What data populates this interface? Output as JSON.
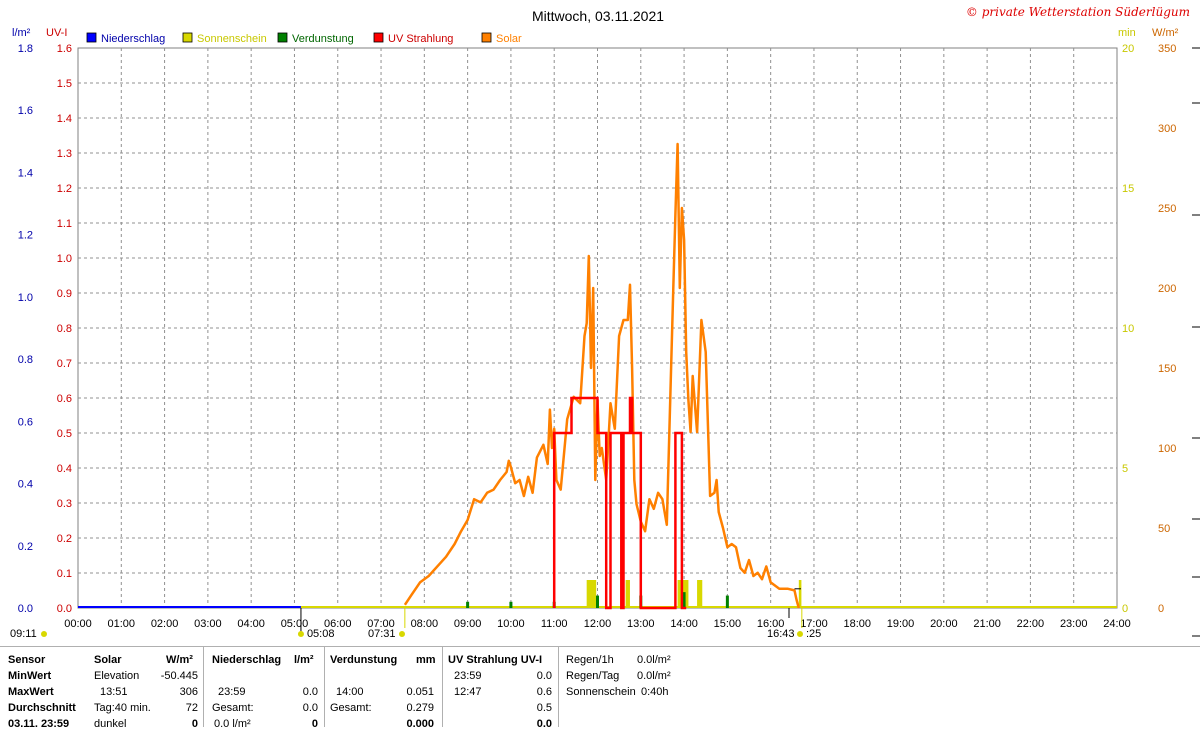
{
  "chart_data": {
    "type": "line",
    "title": "Mittwoch, 03.11.2021",
    "copyright": "© private Wetterstation Süderlügum",
    "axes": {
      "left_outer": {
        "unit": "l/m²",
        "min": 0,
        "max": 1.8,
        "ticks": [
          "0.0",
          "0.2",
          "0.4",
          "0.6",
          "0.8",
          "1.0",
          "1.2",
          "1.4",
          "1.6",
          "1.8"
        ],
        "color": "#0000aa"
      },
      "left_inner": {
        "unit": "UV-I",
        "min": 0,
        "max": 1.6,
        "ticks": [
          "0.0",
          "0.1",
          "0.2",
          "0.3",
          "0.4",
          "0.5",
          "0.6",
          "0.7",
          "0.8",
          "0.9",
          "1.0",
          "1.1",
          "1.2",
          "1.3",
          "1.4",
          "1.5",
          "1.6"
        ],
        "color": "#cc0000"
      },
      "right_inner": {
        "unit": "min",
        "min": 0,
        "max": 20,
        "ticks": [
          "0",
          "5",
          "10",
          "15",
          "20"
        ],
        "color": "#c8c800"
      },
      "right_outer": {
        "unit": "W/m²",
        "min": 0,
        "max": 350,
        "ticks": [
          "0",
          "50",
          "100",
          "150",
          "200",
          "250",
          "300",
          "350"
        ],
        "color": "#cc6600"
      },
      "x": {
        "min": 0,
        "max": 24,
        "ticks": [
          "00:00",
          "01:00",
          "02:00",
          "03:00",
          "04:00",
          "05:00",
          "06:00",
          "07:00",
          "08:00",
          "09:00",
          "10:00",
          "11:00",
          "12:00",
          "13:00",
          "14:00",
          "15:00",
          "16:00",
          "17:00",
          "18:00",
          "19:00",
          "20:00",
          "21:00",
          "22:00",
          "23:00",
          "24:00"
        ]
      }
    },
    "grid": true,
    "legend_position": "top-left",
    "legend": [
      {
        "name": "Niederschlag",
        "color": "#0000ff",
        "text_color": "#0000aa"
      },
      {
        "name": "Sonnenschein",
        "color": "#d8d800",
        "text_color": "#c8c800"
      },
      {
        "name": "Verdunstung",
        "color": "#008000",
        "text_color": "#006600"
      },
      {
        "name": "UV Strahlung",
        "color": "#ff0000",
        "text_color": "#cc0000"
      },
      {
        "name": "Solar",
        "color": "#ff8000",
        "text_color": "#ff8000"
      }
    ],
    "markers": {
      "left_label": "09:11",
      "sunrise_a": "05:08",
      "sunrise_b": "07:31",
      "sunset_a": "16:43",
      "sunset_b": ":25"
    },
    "series": [
      {
        "name": "Solar",
        "axis": "right_outer",
        "color": "#ff8000",
        "x": [
          7.55,
          7.7,
          7.9,
          8.1,
          8.3,
          8.5,
          8.7,
          8.85,
          9.0,
          9.15,
          9.3,
          9.45,
          9.6,
          9.75,
          9.9,
          9.95,
          10.0,
          10.1,
          10.2,
          10.3,
          10.4,
          10.5,
          10.6,
          10.75,
          10.85,
          10.9,
          10.95,
          11.0,
          11.05,
          11.15,
          11.3,
          11.45,
          11.6,
          11.7,
          11.75,
          11.8,
          11.85,
          11.9,
          11.95,
          12.0,
          12.05,
          12.1,
          12.2,
          12.3,
          12.4,
          12.5,
          12.6,
          12.7,
          12.75,
          12.8,
          12.85,
          12.9,
          13.0,
          13.1,
          13.2,
          13.3,
          13.4,
          13.5,
          13.6,
          13.7,
          13.75,
          13.8,
          13.85,
          13.9,
          13.95,
          14.0,
          14.05,
          14.1,
          14.15,
          14.2,
          14.3,
          14.4,
          14.5,
          14.6,
          14.7,
          14.75,
          14.8,
          14.9,
          15.0,
          15.1,
          15.2,
          15.3,
          15.4,
          15.5,
          15.6,
          15.7,
          15.8,
          15.9,
          16.0,
          16.2,
          16.4,
          16.55,
          16.6,
          16.65
        ],
        "values": [
          2,
          8,
          16,
          20,
          26,
          32,
          40,
          48,
          55,
          68,
          66,
          72,
          74,
          80,
          85,
          92,
          88,
          78,
          80,
          70,
          82,
          72,
          94,
          102,
          90,
          124,
          100,
          112,
          80,
          74,
          118,
          132,
          128,
          170,
          178,
          220,
          150,
          200,
          80,
          130,
          95,
          100,
          80,
          128,
          112,
          170,
          180,
          180,
          202,
          150,
          80,
          65,
          54,
          48,
          68,
          62,
          72,
          68,
          52,
          150,
          200,
          246,
          290,
          200,
          250,
          230,
          160,
          130,
          110,
          145,
          110,
          180,
          160,
          70,
          72,
          80,
          60,
          50,
          38,
          40,
          38,
          25,
          22,
          30,
          20,
          22,
          18,
          26,
          16,
          12,
          12,
          11,
          5,
          0
        ]
      },
      {
        "name": "UV Strahlung",
        "axis": "left_inner",
        "color": "#ff0000",
        "x": [
          11.0,
          11.0,
          11.0,
          11.05,
          11.4,
          11.4,
          12.0,
          12.0,
          12.2,
          12.2,
          12.3,
          12.3,
          12.55,
          12.55,
          12.6,
          12.6,
          12.75,
          12.75,
          12.8,
          12.8,
          12.9,
          12.9,
          13.0,
          13.0,
          13.05,
          13.05,
          13.8,
          13.8,
          13.9,
          13.95,
          13.95,
          14.05,
          14.05
        ],
        "values": [
          0,
          0.2,
          0.5,
          0.5,
          0.5,
          0.6,
          0.6,
          0.5,
          0.5,
          0.0,
          0.0,
          0.5,
          0.5,
          0.0,
          0.0,
          0.5,
          0.5,
          0.6,
          0.6,
          0.5,
          0.5,
          0.5,
          0.5,
          0.0,
          0.0,
          0.0,
          0.0,
          0.5,
          0.5,
          0.5,
          0.0,
          0.0,
          0.0
        ]
      },
      {
        "name": "Sonnenschein",
        "axis": "right_inner",
        "bars": [
          {
            "x": 11.75,
            "w": 0.22,
            "v": 1.0
          },
          {
            "x": 12.65,
            "w": 0.1,
            "v": 1.0
          },
          {
            "x": 13.85,
            "w": 0.25,
            "v": 1.0
          },
          {
            "x": 14.3,
            "w": 0.12,
            "v": 1.0
          },
          {
            "x": 16.65,
            "w": 0.06,
            "v": 1.0
          }
        ]
      },
      {
        "name": "Verdunstung",
        "axis": "left_outer",
        "bars": [
          {
            "x": 9.0,
            "v": 0.02
          },
          {
            "x": 10.0,
            "v": 0.02
          },
          {
            "x": 11.0,
            "v": 0.02
          },
          {
            "x": 12.0,
            "v": 0.04
          },
          {
            "x": 13.0,
            "v": 0.04
          },
          {
            "x": 14.0,
            "v": 0.051
          },
          {
            "x": 15.0,
            "v": 0.04
          }
        ]
      },
      {
        "name": "Niederschlag",
        "axis": "left_outer",
        "values_all_zero": true
      }
    ]
  },
  "stats": {
    "headers": [
      "Sensor",
      "Solar",
      "W/m²",
      "Niederschlag",
      "l/m²",
      "Verdunstung",
      "mm",
      "UV Strahlung UV-I"
    ],
    "row_labels": [
      "MinWert",
      "MaxWert",
      "Durchschnitt",
      "03.11. 23:59"
    ],
    "solar": [
      [
        "Elevation",
        "-50.445"
      ],
      [
        "13:51",
        "306"
      ],
      [
        "Tag:40 min.",
        "72"
      ],
      [
        "dunkel",
        "0"
      ]
    ],
    "niederschlag": [
      [
        "",
        ""
      ],
      [
        "23:59",
        "0.0"
      ],
      [
        "Gesamt:",
        "0.0"
      ],
      [
        "0.0 l/m²",
        "0"
      ]
    ],
    "verdunstung": [
      [
        "",
        ""
      ],
      [
        "14:00",
        "0.051"
      ],
      [
        "Gesamt:",
        "0.279"
      ],
      [
        "",
        "0.000"
      ]
    ],
    "uv": [
      [
        "23:59",
        "0.0"
      ],
      [
        "12:47",
        "0.6"
      ],
      [
        "",
        "0.5"
      ],
      [
        "",
        "0.0"
      ]
    ],
    "regen": [
      [
        "Regen/1h",
        "0.0l/m²"
      ],
      [
        "Regen/Tag",
        "0.0l/m²"
      ],
      [
        "Sonnenschein",
        "0:40h"
      ]
    ]
  }
}
